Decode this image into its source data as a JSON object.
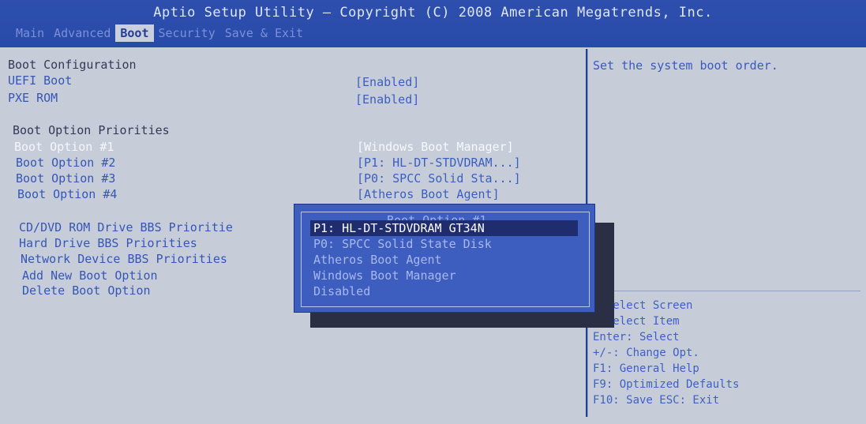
{
  "header": {
    "title": "Aptio Setup Utility – Copyright (C) 2008 American Megatrends, Inc.",
    "tabs": [
      "Main",
      "Advanced",
      "Boot",
      "Security",
      "Save & Exit"
    ]
  },
  "main": {
    "boot_configuration": {
      "heading": "Boot Configuration",
      "items": [
        {
          "label": "UEFI Boot",
          "value": "[Enabled]"
        },
        {
          "label": "PXE ROM",
          "value": "[Enabled]"
        }
      ]
    },
    "boot_priorities": {
      "heading": "Boot Option Priorities",
      "items": [
        {
          "label": "Boot Option #1",
          "value": "[Windows Boot Manager]"
        },
        {
          "label": "Boot Option #2",
          "value": "[P1: HL-DT-STDVDRAM...]"
        },
        {
          "label": "Boot Option #3",
          "value": "[P0: SPCC Solid Sta...]"
        },
        {
          "label": "Boot Option #4",
          "value": "[Atheros Boot Agent]"
        }
      ]
    },
    "submenus": [
      "CD/DVD ROM Drive BBS Prioritie",
      "Hard Drive BBS Priorities",
      "Network Device BBS Priorities",
      "Add New Boot Option",
      "Delete Boot Option"
    ]
  },
  "help": {
    "text": "Set the system boot order.",
    "keys": [
      ": Select Screen",
      ": Select Item",
      "Enter: Select",
      "+/-: Change Opt.",
      "F1: General Help",
      "F9: Optimized Defaults",
      "F10: Save  ESC: Exit"
    ]
  },
  "popup": {
    "title": "Boot Option #1",
    "options": [
      "P1: HL-DT-STDVDRAM GT34N",
      "P0: SPCC Solid State Disk",
      "Atheros Boot Agent",
      "Windows Boot Manager",
      "Disabled"
    ],
    "selected_index": 0
  }
}
